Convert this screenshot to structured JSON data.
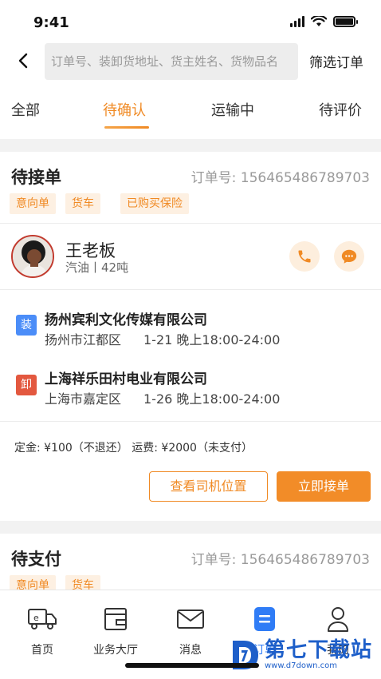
{
  "status_bar": {
    "time": "9:41"
  },
  "search": {
    "placeholder": "订单号、装卸货地址、货主姓名、货物品名",
    "filter_label": "筛选订单"
  },
  "tabs": [
    {
      "label": "全部",
      "active": false
    },
    {
      "label": "待确认",
      "active": true
    },
    {
      "label": "运输中",
      "active": false
    },
    {
      "label": "待评价",
      "active": false
    }
  ],
  "orders": [
    {
      "status": "待接单",
      "order_no": "订单号: 156465486789703",
      "tags": [
        "意向单",
        "货车",
        "已购买保险"
      ],
      "driver": {
        "name": "王老板",
        "truck_info": "汽油丨42吨"
      },
      "load": {
        "badge": "装",
        "company": "扬州宾利文化传媒有限公司",
        "address": "扬州市江都区",
        "time": "1-21 晚上18:00-24:00"
      },
      "unload": {
        "badge": "卸",
        "company": "上海祥乐田村电业有限公司",
        "address": "上海市嘉定区",
        "time": "1-26 晚上18:00-24:00"
      },
      "fees": "定金: ¥100（不退还） 运费: ¥2000（未支付）",
      "buttons": {
        "view_location": "查看司机位置",
        "accept": "立即接单"
      }
    },
    {
      "status": "待支付",
      "order_no": "订单号: 156465486789703",
      "tags": [
        "意向单",
        "货车"
      ]
    }
  ],
  "tabbar": [
    {
      "label": "首页",
      "icon": "truck-icon",
      "active": false
    },
    {
      "label": "业务大厅",
      "icon": "wallet-icon",
      "active": false
    },
    {
      "label": "消息",
      "icon": "mail-icon",
      "active": false
    },
    {
      "label": "订单",
      "icon": "order-document-icon",
      "active": true
    },
    {
      "label": "我的",
      "icon": "user-icon",
      "active": false
    }
  ],
  "watermark": {
    "text": "第七下载站",
    "url_text": "www.d7down.com"
  },
  "colors": {
    "accent": "#f08a24",
    "tag_bg": "#fdf0e2",
    "load_badge": "#4b8df8",
    "unload_badge": "#e3583f",
    "active_tab_blue": "#2f7cf6"
  }
}
